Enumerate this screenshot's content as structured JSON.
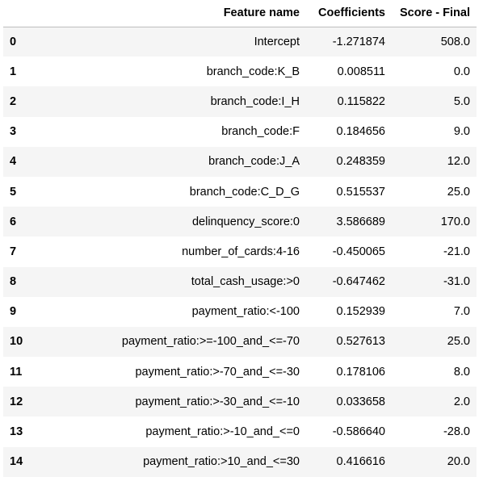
{
  "table": {
    "columns": [
      "",
      "Feature name",
      "Coefficients",
      "Score - Final"
    ],
    "rows": [
      {
        "index": "0",
        "feature": "Intercept",
        "coef": "-1.271874",
        "score": "508.0"
      },
      {
        "index": "1",
        "feature": "branch_code:K_B",
        "coef": "0.008511",
        "score": "0.0"
      },
      {
        "index": "2",
        "feature": "branch_code:I_H",
        "coef": "0.115822",
        "score": "5.0"
      },
      {
        "index": "3",
        "feature": "branch_code:F",
        "coef": "0.184656",
        "score": "9.0"
      },
      {
        "index": "4",
        "feature": "branch_code:J_A",
        "coef": "0.248359",
        "score": "12.0"
      },
      {
        "index": "5",
        "feature": "branch_code:C_D_G",
        "coef": "0.515537",
        "score": "25.0"
      },
      {
        "index": "6",
        "feature": "delinquency_score:0",
        "coef": "3.586689",
        "score": "170.0"
      },
      {
        "index": "7",
        "feature": "number_of_cards:4-16",
        "coef": "-0.450065",
        "score": "-21.0"
      },
      {
        "index": "8",
        "feature": "total_cash_usage:>0",
        "coef": "-0.647462",
        "score": "-31.0"
      },
      {
        "index": "9",
        "feature": "payment_ratio:<-100",
        "coef": "0.152939",
        "score": "7.0"
      },
      {
        "index": "10",
        "feature": "payment_ratio:>=-100_and_<=-70",
        "coef": "0.527613",
        "score": "25.0"
      },
      {
        "index": "11",
        "feature": "payment_ratio:>-70_and_<=-30",
        "coef": "0.178106",
        "score": "8.0"
      },
      {
        "index": "12",
        "feature": "payment_ratio:>-30_and_<=-10",
        "coef": "0.033658",
        "score": "2.0"
      },
      {
        "index": "13",
        "feature": "payment_ratio:>-10_and_<=0",
        "coef": "-0.586640",
        "score": "-28.0"
      },
      {
        "index": "14",
        "feature": "payment_ratio:>10_and_<=30",
        "coef": "0.416616",
        "score": "20.0"
      }
    ]
  },
  "colors": {
    "stripe": "#f5f5f5",
    "header_rule": "#bdbdbd"
  }
}
